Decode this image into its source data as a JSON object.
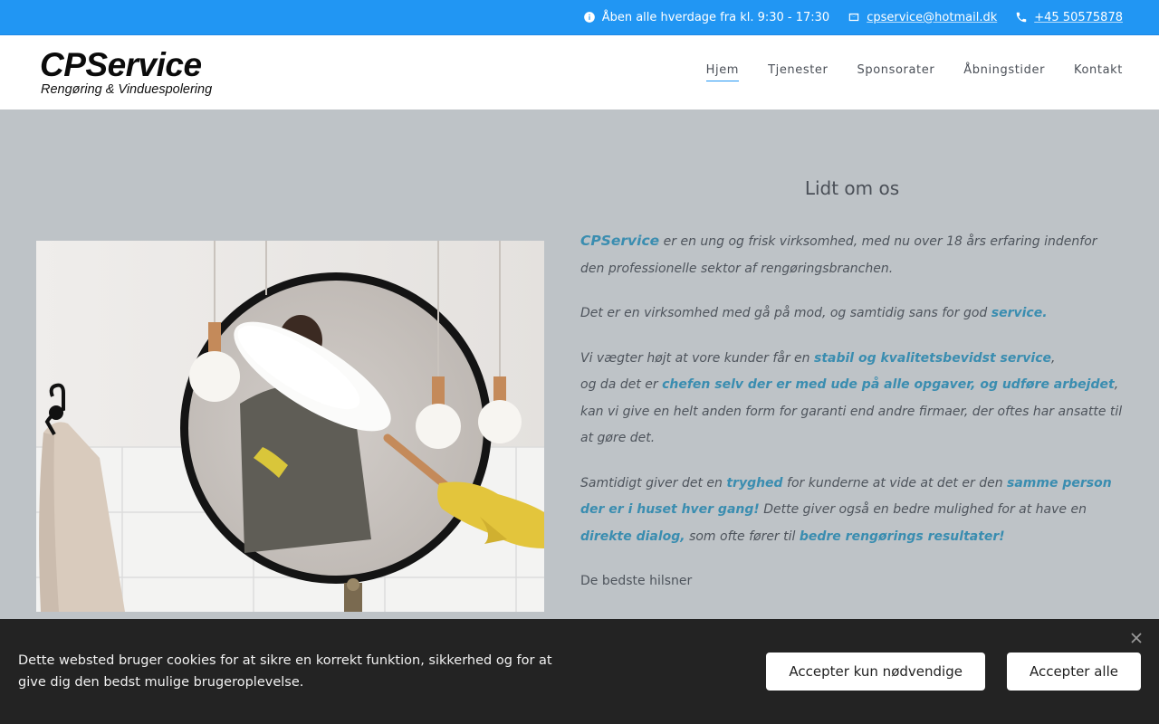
{
  "topbar": {
    "hours_text": "Åben alle hverdage fra kl. 9:30 - 17:30",
    "email": "cpservice@hotmail.dk",
    "phone": "+45 50575878"
  },
  "logo": {
    "main": "CPService",
    "sub": "Rengøring & Vinduespolering"
  },
  "nav": {
    "items": [
      {
        "label": "Hjem",
        "active": true
      },
      {
        "label": "Tjenester"
      },
      {
        "label": "Sponsorater"
      },
      {
        "label": "Åbningstider"
      },
      {
        "label": "Kontakt"
      }
    ]
  },
  "about": {
    "title": "Lidt om os",
    "p1": {
      "brand": "CPService",
      "rest": " er en ung og frisk virksomhed, med nu over 18 års erfaring indenfor den professionelle sektor af rengøringsbranchen."
    },
    "p2": {
      "pre": "Det er en virksomhed med gå på mod, og samtidig sans for god ",
      "hl": "service."
    },
    "p3": {
      "pre": "Vi vægter højt at vore kunder får en ",
      "hl1": "stabil og kvalitetsbevidst service",
      "mid1": ",",
      "mid2": "og da det er ",
      "hl2": "chefen selv der er med ude på alle opgaver, og udføre arbejdet",
      "mid3": ",",
      "post": "kan vi give en helt anden form for garanti end andre firmaer, der oftes har ansatte til at gøre det."
    },
    "p4": {
      "pre": "Samtidigt giver det en ",
      "hl1": "tryghed",
      "mid1": " for kunderne at vide at det er den ",
      "hl2": "samme person der er i huset hver gang!",
      "mid2": " Dette giver også en bedre mulighed for at have en ",
      "hl3": "direkte dialog,",
      "mid3": " som ofte fører til ",
      "hl4": "bedre rengørings resultater!"
    },
    "regards": "De bedste hilsner"
  },
  "cookie": {
    "text": "Dette websted bruger cookies for at sikre en korrekt funktion, sikkerhed og for at give dig den bedst mulige brugeroplevelse.",
    "btn_necessary": "Accepter kun nødvendige",
    "btn_all": "Accepter alle"
  },
  "colors": {
    "topbar_bg": "#2196f3",
    "accent_text": "#3a8db0",
    "page_bg": "#bec3c7",
    "cookie_bg": "#232323"
  },
  "icons": {
    "hours": "info-icon",
    "email": "mail-icon",
    "phone": "phone-icon",
    "cookie_close": "close-icon"
  }
}
